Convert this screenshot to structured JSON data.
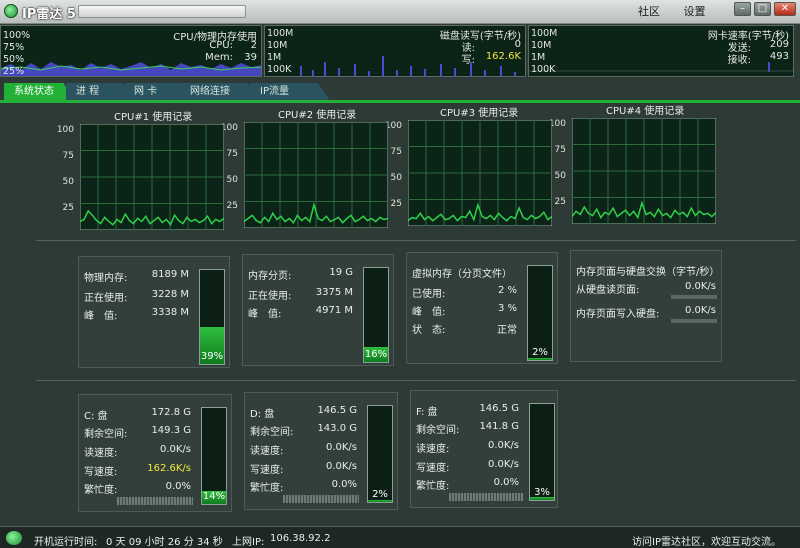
{
  "app": {
    "title": "IP雷达 5",
    "links": [
      "社区",
      "设置"
    ],
    "window_buttons": [
      "minimize",
      "maximize",
      "close"
    ]
  },
  "monitors": {
    "cpu": {
      "title": "CPU/物理内存使用",
      "scale": [
        "100%",
        "75%",
        "50%",
        "25%"
      ],
      "cpu_label": "CPU:",
      "cpu_value": "2",
      "mem_label": "Mem:",
      "mem_value": "39"
    },
    "disk": {
      "title": "磁盘读写(字节/秒)",
      "scale": [
        "100M",
        "10M",
        "1M",
        "100K"
      ],
      "read_label": "读:",
      "read_value": "0",
      "write_label": "写:",
      "write_value": "162.6K"
    },
    "net": {
      "title": "网卡速率(字节/秒)",
      "scale": [
        "100M",
        "10M",
        "1M",
        "100K"
      ],
      "send_label": "发送:",
      "send_value": "209",
      "recv_label": "接收:",
      "recv_value": "493"
    }
  },
  "tabs": [
    "系统状态",
    "进 程",
    "网 卡",
    "网络连接",
    "IP流量"
  ],
  "cpu_charts": {
    "axis": [
      "100",
      "75",
      "50",
      "25"
    ],
    "titles": [
      "CPU#1 使用记录",
      "CPU#2 使用记录",
      "CPU#3 使用记录",
      "CPU#4 使用记录"
    ]
  },
  "chart_data": {
    "type": "line",
    "ylim": [
      0,
      100
    ],
    "series": [
      {
        "name": "CPU#1 使用记录",
        "values": [
          8,
          10,
          18,
          14,
          9,
          6,
          12,
          8,
          5,
          10,
          7,
          15,
          9,
          6,
          11,
          8,
          13,
          6,
          9,
          12,
          7,
          10,
          5,
          14,
          9,
          6,
          12,
          8,
          10,
          7,
          9,
          13,
          6,
          10,
          8,
          11
        ]
      },
      {
        "name": "CPU#2 使用记录",
        "values": [
          6,
          9,
          12,
          7,
          5,
          10,
          6,
          14,
          8,
          11,
          6,
          9,
          5,
          12,
          7,
          10,
          6,
          22,
          9,
          7,
          11,
          6,
          8,
          10,
          5,
          9,
          12,
          6,
          8,
          11,
          7,
          9,
          6,
          10,
          8,
          9
        ]
      },
      {
        "name": "CPU#3 使用记录",
        "values": [
          5,
          8,
          7,
          12,
          6,
          9,
          5,
          8,
          11,
          6,
          7,
          10,
          5,
          9,
          8,
          14,
          6,
          20,
          9,
          7,
          10,
          6,
          12,
          8,
          5,
          9,
          7,
          17,
          8,
          6,
          10,
          7,
          9,
          13,
          6,
          9
        ]
      },
      {
        "name": "CPU#4 使用记录",
        "values": [
          7,
          12,
          9,
          16,
          10,
          8,
          14,
          6,
          11,
          9,
          15,
          7,
          10,
          13,
          8,
          12,
          6,
          20,
          9,
          11,
          7,
          14,
          8,
          10,
          6,
          13,
          9,
          11,
          7,
          15,
          8,
          12,
          9,
          10,
          7,
          11
        ]
      }
    ]
  },
  "memory": {
    "physical": {
      "rows": [
        [
          "物理内存:",
          "8189 M"
        ],
        [
          "正在使用:",
          "3228 M"
        ],
        [
          "峰　值:",
          "3338 M"
        ]
      ],
      "gauge": "39%",
      "level": 0.39
    },
    "paging": {
      "rows": [
        [
          "内存分页:",
          "19 G"
        ],
        [
          "正在使用:",
          "3375 M"
        ],
        [
          "峰　值:",
          "4971 M"
        ]
      ],
      "gauge": "16%",
      "level": 0.16
    },
    "virtual": {
      "title": "虚拟内存（分页文件）",
      "rows": [
        [
          "已使用:",
          "2 %"
        ],
        [
          "峰　值:",
          "3 %"
        ],
        [
          "状　态:",
          "正常"
        ]
      ],
      "gauge": "2%",
      "level": 0.02
    },
    "swap": {
      "title": "内存页面与硬盘交换（字节/秒）",
      "rows": [
        [
          "从硬盘读页面:",
          "0.0K/s"
        ],
        [
          "内存页面写入硬盘:",
          "0.0K/s"
        ]
      ]
    }
  },
  "drives": [
    {
      "name": "C: 盘",
      "size": "172.8 G",
      "rows": [
        [
          "剩余空间:",
          "149.3 G"
        ],
        [
          "读速度:",
          "0.0K/s"
        ],
        [
          "写速度:",
          "162.6K/s"
        ],
        [
          "繁忙度:",
          "0.0%"
        ]
      ],
      "gauge": "14%",
      "level": 0.14,
      "write_highlight": true
    },
    {
      "name": "D: 盘",
      "size": "146.5 G",
      "rows": [
        [
          "剩余空间:",
          "143.0 G"
        ],
        [
          "读速度:",
          "0.0K/s"
        ],
        [
          "写速度:",
          "0.0K/s"
        ],
        [
          "繁忙度:",
          "0.0%"
        ]
      ],
      "gauge": "2%",
      "level": 0.02,
      "write_highlight": false
    },
    {
      "name": "F: 盘",
      "size": "146.5 G",
      "rows": [
        [
          "剩余空间:",
          "141.8 G"
        ],
        [
          "读速度:",
          "0.0K/s"
        ],
        [
          "写速度:",
          "0.0K/s"
        ],
        [
          "繁忙度:",
          "0.0%"
        ]
      ],
      "gauge": "3%",
      "level": 0.03,
      "write_highlight": false
    }
  ],
  "status": {
    "uptime_label": "开机运行时间:",
    "uptime_value": "0 天 09 小时 26 分 34 秒",
    "ip_label": "上网IP:",
    "ip_value": "106.38.92.2",
    "message": "访问IP雷达社区，欢迎互动交流。"
  },
  "colors": {
    "accent": "#23b037",
    "highlight": "#f2e640",
    "chart_bg": "#0c2318",
    "chart_line": "#2fd14a"
  }
}
